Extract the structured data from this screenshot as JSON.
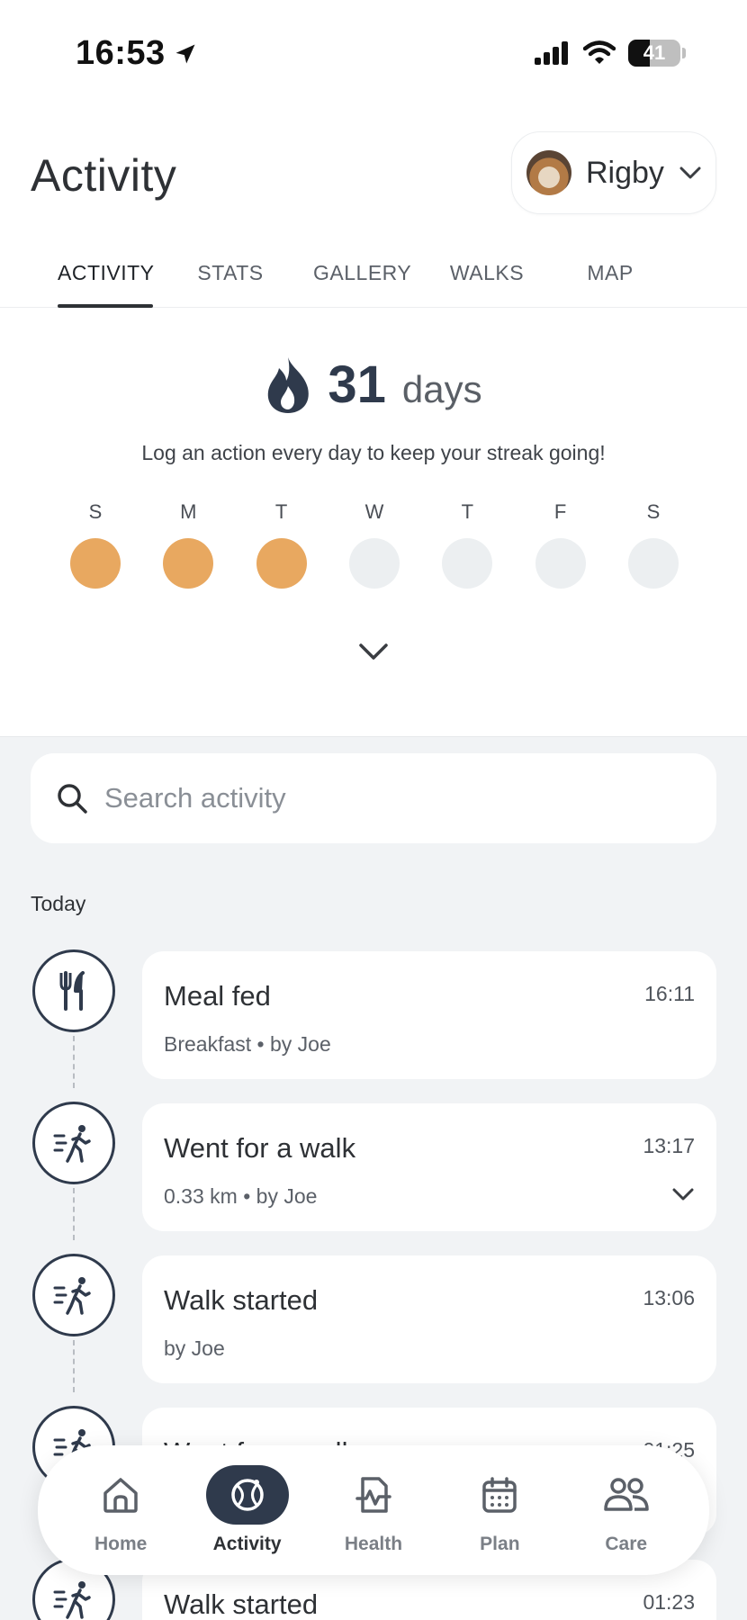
{
  "status_bar": {
    "time": "16:53",
    "battery": "41"
  },
  "header": {
    "title": "Activity",
    "pet_name": "Rigby"
  },
  "tabs": [
    {
      "label": "ACTIVITY",
      "active": true
    },
    {
      "label": "STATS",
      "active": false
    },
    {
      "label": "GALLERY",
      "active": false
    },
    {
      "label": "WALKS",
      "active": false
    },
    {
      "label": "MAP",
      "active": false
    }
  ],
  "streak": {
    "count": "31",
    "unit": "days",
    "hint": "Log an action every day to keep your streak going!",
    "days": [
      {
        "label": "S",
        "done": true
      },
      {
        "label": "M",
        "done": true
      },
      {
        "label": "T",
        "done": true
      },
      {
        "label": "W",
        "done": false
      },
      {
        "label": "T",
        "done": false
      },
      {
        "label": "F",
        "done": false
      },
      {
        "label": "S",
        "done": false
      }
    ]
  },
  "search": {
    "placeholder": "Search activity"
  },
  "feed": {
    "section_label": "Today",
    "items": [
      {
        "icon": "cutlery-icon",
        "title": "Meal fed",
        "time": "16:11",
        "subtitle": "Breakfast • by Joe"
      },
      {
        "icon": "walk-icon",
        "title": "Went for a walk",
        "time": "13:17",
        "subtitle": "0.33 km • by Joe"
      },
      {
        "icon": "walk-icon",
        "title": "Walk started",
        "time": "13:06",
        "subtitle": "by Joe"
      },
      {
        "icon": "walk-icon",
        "title": "Went for a walk",
        "time": "01:25",
        "subtitle": ""
      },
      {
        "icon": "walk-icon",
        "title": "Walk started",
        "time": "01:23",
        "subtitle": ""
      }
    ]
  },
  "bottom_nav": [
    {
      "label": "Home",
      "icon": "home-icon",
      "active": false
    },
    {
      "label": "Activity",
      "icon": "ball-icon",
      "active": true
    },
    {
      "label": "Health",
      "icon": "health-icon",
      "active": false
    },
    {
      "label": "Plan",
      "icon": "calendar-icon",
      "active": false
    },
    {
      "label": "Care",
      "icon": "people-icon",
      "active": false
    }
  ],
  "colors": {
    "accent": "#2f3a4c",
    "streak_done": "#e8a860",
    "streak_empty": "#eceff1",
    "feed_bg": "#f1f3f5"
  }
}
